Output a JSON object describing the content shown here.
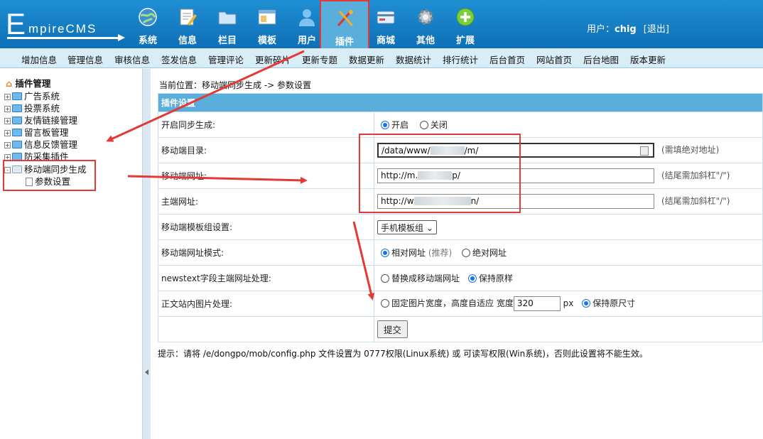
{
  "header": {
    "logo_text_e": "E",
    "logo_text_rest": "mpireCMS",
    "nav": [
      {
        "label": "系统",
        "icon": "globe-icon"
      },
      {
        "label": "信息",
        "icon": "document-pencil-icon"
      },
      {
        "label": "栏目",
        "icon": "folder-icon"
      },
      {
        "label": "模板",
        "icon": "window-template-icon"
      },
      {
        "label": "用户",
        "icon": "user-icon"
      },
      {
        "label": "插件",
        "icon": "tools-icon",
        "active": true
      },
      {
        "label": "商城",
        "icon": "credit-card-icon"
      },
      {
        "label": "其他",
        "icon": "gear-icon"
      },
      {
        "label": "扩展",
        "icon": "plus-circle-icon"
      }
    ],
    "user_prefix": "用户：",
    "username": "chig",
    "logout": "[退出]"
  },
  "submenu": [
    "增加信息",
    "管理信息",
    "审核信息",
    "签发信息",
    "管理评论",
    "更新碎片",
    "更新专题",
    "数据更新",
    "数据统计",
    "排行统计",
    "后台首页",
    "网站首页",
    "后台地图",
    "版本更新"
  ],
  "sidebar": {
    "root": "插件管理",
    "items": [
      {
        "label": "广告系统",
        "expander": "+"
      },
      {
        "label": "投票系统",
        "expander": "+"
      },
      {
        "label": "友情链接管理",
        "expander": "+"
      },
      {
        "label": "留言板管理",
        "expander": "+"
      },
      {
        "label": "信息反馈管理",
        "expander": "+"
      },
      {
        "label": "防采集插件",
        "expander": "+"
      },
      {
        "label": "移动端同步生成",
        "expander": "-"
      }
    ],
    "child": "参数设置"
  },
  "main": {
    "breadcrumb": "当前位置：移动端同步生成 -> 参数设置",
    "section_title": "插件设置",
    "rows": {
      "sync_label": "开启同步生成:",
      "sync_on": "开启",
      "sync_off": "关闭",
      "dir_label": "移动端目录:",
      "dir_value_a": "/data/www/",
      "dir_value_b": "/m/",
      "dir_hint": "(需填绝对地址)",
      "murl_label": "移动端网址:",
      "murl_value_a": "http://m.",
      "murl_value_b": "p/",
      "murl_hint": "(结尾需加斜杠\"/\")",
      "url_label": "主端网址:",
      "url_value_a": "http://w",
      "url_value_b": "n/",
      "url_hint": "(结尾需加斜杠\"/\")",
      "tplgroup_label": "移动端模板组设置:",
      "tplgroup_value": "手机模板组",
      "urlmode_label": "移动端网址模式:",
      "urlmode_rel": "相对网址",
      "urlmode_rel_note": "(推荐)",
      "urlmode_abs": "绝对网址",
      "newstext_label": "newstext字段主端网址处理:",
      "newstext_replace": "替换成移动端网址",
      "newstext_keep": "保持原样",
      "img_label": "正文站内图片处理:",
      "img_fixed": "固定图片宽度，高度自适应 宽度",
      "img_width": "320",
      "img_px": "px",
      "img_keep": "保持原尺寸",
      "submit": "提交"
    },
    "tip": "提示：请将 /e/dongpo/mob/config.php 文件设置为 0777权限(Linux系统) 或 可读写权限(Win系统)，否则此设置将不能生效。"
  },
  "colors": {
    "header": "#1f8fd4",
    "submenu": "#d9edf7",
    "section_head": "#5aaedc",
    "annotation_red": "#e53935",
    "radio_blue": "#1a73e8"
  }
}
